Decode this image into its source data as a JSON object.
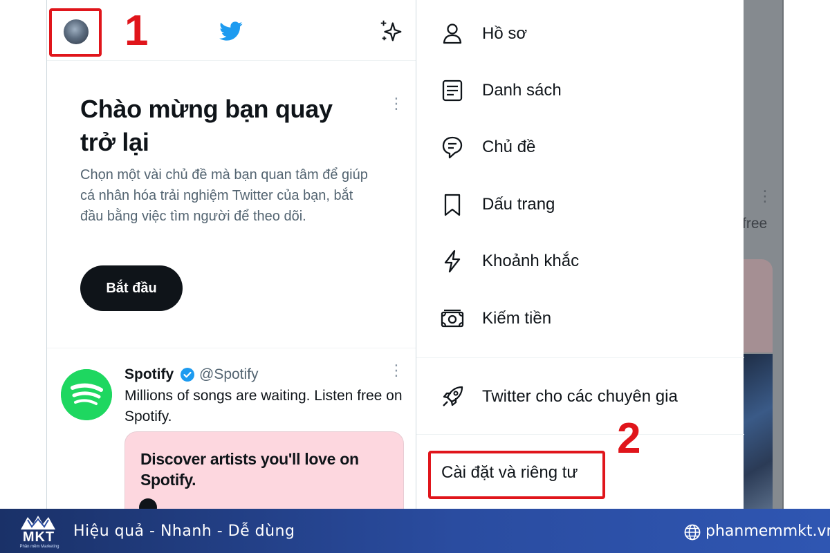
{
  "feed": {
    "welcome": {
      "title": "Chào mừng bạn quay trở lại",
      "description": "Chọn một vài chủ đề mà bạn quan tâm để giúp cá nhân hóa trải nghiệm Twitter của bạn, bắt đầu bằng việc tìm người để theo dõi.",
      "more": "⋮",
      "start_label": "Bắt đầu"
    },
    "tweet": {
      "name": "Spotify",
      "handle": "@Spotify",
      "text": "Millions of songs are waiting. Listen free on Spotify.",
      "more": "⋮",
      "card_title": "Discover artists you'll love on Spotify."
    }
  },
  "drawer": {
    "items": [
      {
        "label": "Hồ sơ",
        "icon": "profile-icon"
      },
      {
        "label": "Danh sách",
        "icon": "list-icon"
      },
      {
        "label": "Chủ đề",
        "icon": "topics-icon"
      },
      {
        "label": "Dấu trang",
        "icon": "bookmark-icon"
      },
      {
        "label": "Khoảnh khắc",
        "icon": "moments-icon"
      },
      {
        "label": "Kiếm tiền",
        "icon": "monetization-icon"
      },
      {
        "label": "Twitter cho các chuyên gia",
        "icon": "rocket-icon"
      }
    ],
    "settings_label": "Cài đặt và riêng tư"
  },
  "backdrop": {
    "more": "⋮",
    "text": "free"
  },
  "annotations": {
    "step1": "1",
    "step2": "2",
    "color": "#e0151b"
  },
  "footer": {
    "logo_text": "MKT",
    "logo_subtext": "Phần mềm Marketing",
    "slogan": "Hiệu quả - Nhanh  - Dễ dùng",
    "url": "phanmemmkt.vn"
  },
  "colors": {
    "twitter_blue": "#1d9bf0",
    "spotify_green": "#1ed760",
    "footer_blue": "#2a4ca0"
  }
}
